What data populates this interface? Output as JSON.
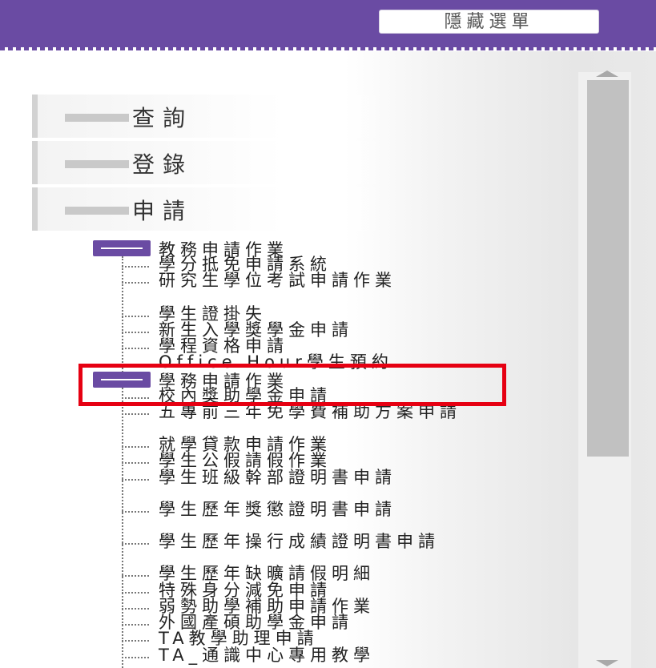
{
  "header": {
    "hide_menu_label": "隱藏選單",
    "accent": "#6a4ba3"
  },
  "categories": [
    {
      "label": "查詢"
    },
    {
      "label": "登錄"
    },
    {
      "label": "申請"
    }
  ],
  "tree": {
    "group1": {
      "label": "教務申請作業",
      "items": [
        "學分抵免申請系統",
        "研究生學位考試申請作業",
        "學生證掛失",
        "新生入學獎學金申請",
        "學程資格申請",
        "Office Hour學生預約"
      ]
    },
    "group2": {
      "label": "學務申請作業",
      "items": [
        "校內獎助學金申請",
        "五專前三年免學費補助方案申請",
        "就學貸款申請作業",
        "學生公假請假作業",
        "學生班級幹部證明書申請",
        "學生歷年獎懲證明書申請",
        "學生歷年操行成績證明書申請",
        "學生歷年缺曠請假明細",
        "特殊身分減免申請",
        "弱勢助學補助申請作業",
        "外國產碩助學金申請",
        "TA教學助理申請",
        "TA_通識中心專用教學"
      ]
    }
  },
  "highlight_color": "#e60012"
}
